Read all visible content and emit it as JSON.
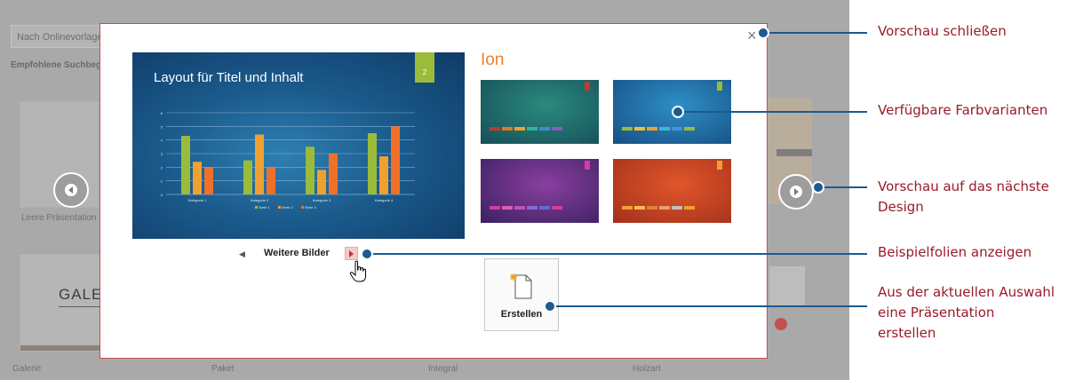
{
  "background": {
    "search_placeholder": "Nach Onlinevorlagen",
    "recommended_label": "Empfohlene Suchbegriffe",
    "blank_caption": "Leere Präsentation",
    "gallery_word": "GALERIE",
    "captions": [
      "Galerie",
      "Paket",
      "Integral",
      "Holzart"
    ]
  },
  "dialog": {
    "close_glyph": "×",
    "theme_name": "Ion",
    "slide_title": "Layout für Titel und Inhalt",
    "slide_number": "2",
    "more_images": "Weitere Bilder",
    "create_label": "Erstellen",
    "variants": [
      {
        "bg_from": "#2b8a7e",
        "bg_to": "#164e58",
        "flag": "#c0392b"
      },
      {
        "bg_from": "#2e8fc6",
        "bg_to": "#174f84",
        "flag": "#9bbb3a"
      },
      {
        "bg_from": "#8a3fa0",
        "bg_to": "#3a2160",
        "flag": "#d63aa5"
      },
      {
        "bg_from": "#e0562b",
        "bg_to": "#a3301b",
        "flag": "#f0a030"
      }
    ],
    "variant_bar_colors": [
      [
        "#c0392b",
        "#e07a28",
        "#f0a030",
        "#2fb3a0",
        "#3d8bc8",
        "#8a5bc0"
      ],
      [
        "#9bbb3a",
        "#f0c030",
        "#f0a030",
        "#40b4d8",
        "#4a90d8",
        "#9bbb3a"
      ],
      [
        "#d63aa5",
        "#e05ab0",
        "#c050c0",
        "#8a6ad0",
        "#5a70d0",
        "#d63aa5"
      ],
      [
        "#f0a030",
        "#f5c050",
        "#e08040",
        "#e0a070",
        "#c0c0c0",
        "#f0a030"
      ]
    ]
  },
  "chart_data": {
    "type": "bar",
    "categories": [
      "Kategorie 1",
      "Kategorie 2",
      "Kategorie 3",
      "Kategorie 4"
    ],
    "series": [
      {
        "name": "Serie 1",
        "values": [
          4.3,
          2.5,
          3.5,
          4.5
        ],
        "color": "#9bbb3a"
      },
      {
        "name": "Serie 2",
        "values": [
          2.4,
          4.4,
          1.8,
          2.8
        ],
        "color": "#f0a030"
      },
      {
        "name": "Serie 3",
        "values": [
          2.0,
          2.0,
          3.0,
          5.0
        ],
        "color": "#f0702a"
      }
    ],
    "y_ticks": [
      0,
      1,
      2,
      3,
      4,
      5,
      6
    ],
    "ylim": [
      0,
      6
    ],
    "grid": true,
    "legend_position": "bottom"
  },
  "callouts": [
    {
      "text": "Vorschau schließen"
    },
    {
      "text": "Verfügbare Farbvarianten"
    },
    {
      "text": "Vorschau auf das nächste Design"
    },
    {
      "text": "Beispielfolien anzeigen"
    },
    {
      "text": "Aus der aktuellen Auswahl eine Präsentation erstellen"
    }
  ],
  "colors": {
    "callout_line": "#1c5a8f",
    "callout_text": "#9a1b2a",
    "theme_title": "#f0802a",
    "dialog_border": "#c0504d"
  }
}
